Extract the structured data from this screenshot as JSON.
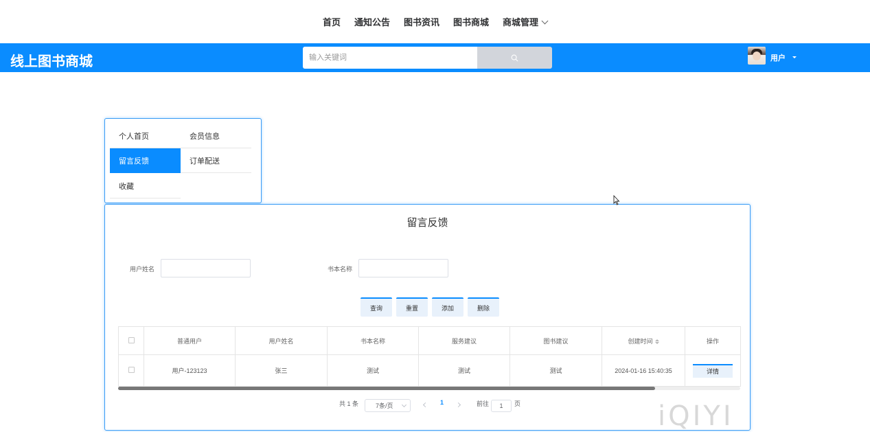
{
  "top_nav": {
    "items": [
      "首页",
      "通知公告",
      "图书资讯",
      "图书商城",
      "商城管理"
    ]
  },
  "header": {
    "brand": "线上图书商城",
    "search_placeholder": "输入关键词",
    "search_icon": "search-icon",
    "user_label": "用户",
    "accent_color": "#0a8cff"
  },
  "side_menu": {
    "items": [
      {
        "label": "个人首页",
        "active": false
      },
      {
        "label": "会员信息",
        "active": false
      },
      {
        "label": "留言反馈",
        "active": true
      },
      {
        "label": "订单配送",
        "active": false
      },
      {
        "label": "收藏",
        "active": false
      }
    ]
  },
  "main": {
    "title": "留言反馈",
    "filters": {
      "user_name_label": "用户姓名",
      "user_name_value": "",
      "book_name_label": "书本名称",
      "book_name_value": ""
    },
    "actions": {
      "query": "查询",
      "reset": "重置",
      "add": "添加",
      "delete": "删除"
    },
    "table": {
      "columns": [
        "普通用户",
        "用户姓名",
        "书本名称",
        "服务建议",
        "图书建议",
        "创建时间",
        "操作"
      ],
      "rows": [
        {
          "user": "用户-123123",
          "name": "张三",
          "book": "测试",
          "service": "测试",
          "book_advice": "测试",
          "created": "2024-01-16 15:40:35",
          "action": "详情"
        }
      ]
    },
    "pagination": {
      "total": "共 1 条",
      "page_size": "7条/页",
      "current_page": "1",
      "goto_label": "前往",
      "goto_value": "1",
      "page_suffix": "页"
    }
  },
  "watermark": "iQIYI"
}
